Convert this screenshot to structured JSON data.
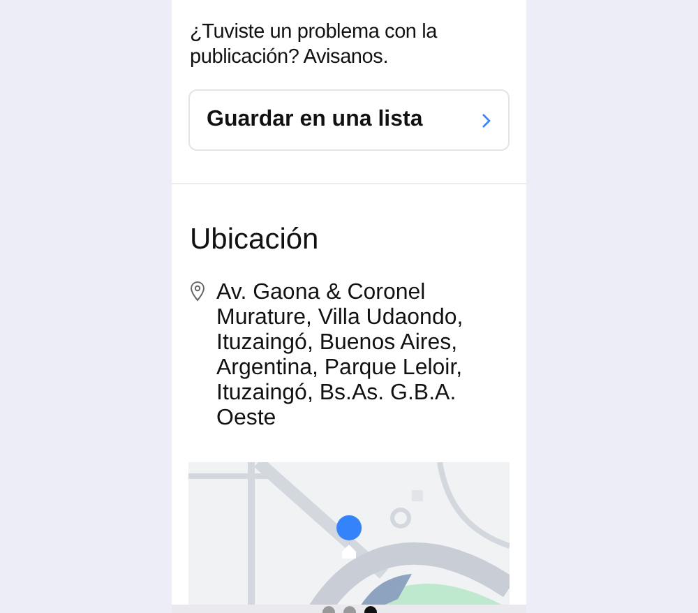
{
  "report": {
    "text": "¿Tuviste un problema con la publicación? Avisanos."
  },
  "save_list": {
    "label": "Guardar en una lista"
  },
  "location": {
    "title": "Ubicación",
    "address": "Av. Gaona & Coronel Murature, Villa Udaondo, Ituzaingó, Buenos Aires, Argentina, Parque Leloir, Ituzaingó, Bs.As. G.B.A. Oeste"
  },
  "pager": [
    {
      "selected": false
    },
    {
      "selected": false
    },
    {
      "selected": true
    }
  ]
}
